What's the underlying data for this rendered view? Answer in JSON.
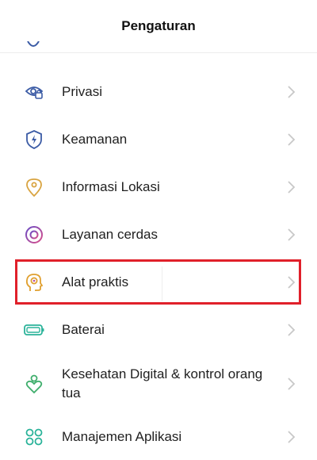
{
  "header": {
    "title": "Pengaturan"
  },
  "settings": {
    "items": [
      {
        "label": "Privasi",
        "icon": "privacy-icon",
        "color": "#3b5ba5"
      },
      {
        "label": "Keamanan",
        "icon": "security-shield-icon",
        "color": "#3b5ba5"
      },
      {
        "label": "Informasi Lokasi",
        "icon": "location-pin-icon",
        "color": "#d9a441"
      },
      {
        "label": "Layanan cerdas",
        "icon": "smart-service-icon",
        "color": "#b44aa4"
      },
      {
        "label": "Alat praktis",
        "icon": "tools-head-icon",
        "color": "#e0a030"
      },
      {
        "label": "Baterai",
        "icon": "battery-icon",
        "color": "#2bb39a"
      },
      {
        "label": "Kesehatan Digital & kontrol orang tua",
        "icon": "digital-wellbeing-icon",
        "color": "#3fae6c"
      },
      {
        "label": "Manajemen Aplikasi",
        "icon": "app-management-icon",
        "color": "#2bb39a"
      }
    ]
  },
  "highlight": {
    "color": "#e0202a",
    "target": "Alat praktis"
  }
}
